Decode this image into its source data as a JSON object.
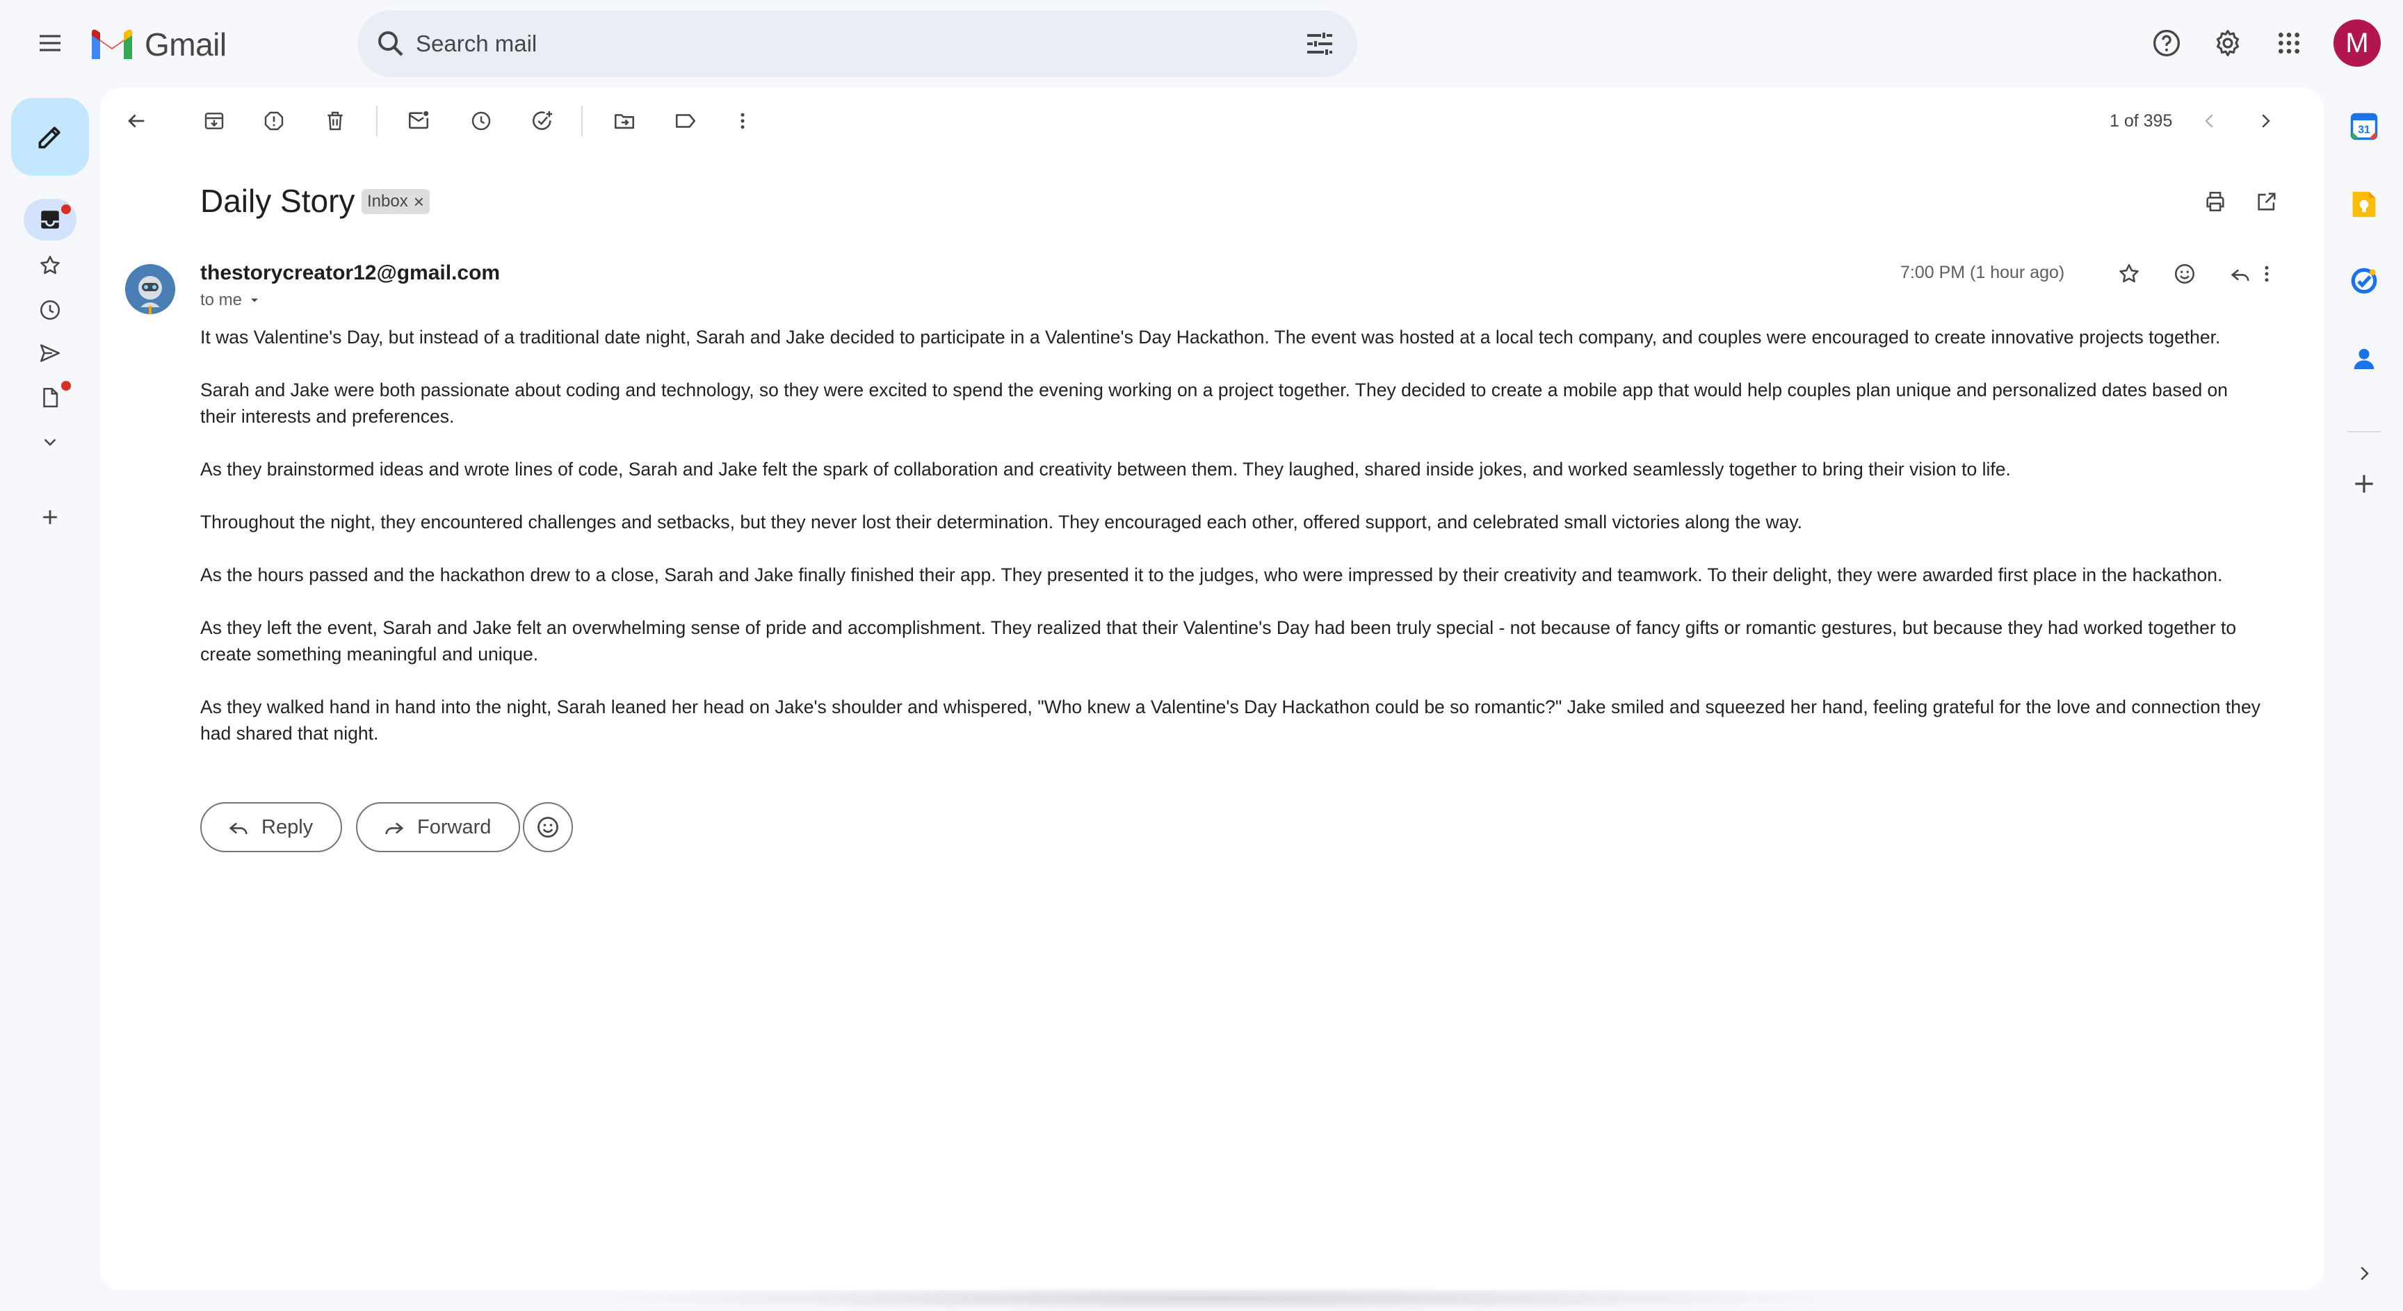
{
  "app": {
    "name": "Gmail"
  },
  "search": {
    "placeholder": "Search mail"
  },
  "account": {
    "initial": "M"
  },
  "toolbar": {
    "counter": "1 of 395"
  },
  "email": {
    "subject": "Daily Story",
    "label": "Inbox",
    "sender": "thestorycreator12@gmail.com",
    "recipient": "to me",
    "time": "7:00 PM (1 hour ago)",
    "paragraphs": [
      "It was Valentine's Day, but instead of a traditional date night, Sarah and Jake decided to participate in a Valentine's Day Hackathon. The event was hosted at a local tech company, and couples were encouraged to create innovative projects together.",
      "Sarah and Jake were both passionate about coding and technology, so they were excited to spend the evening working on a project together. They decided to create a mobile app that would help couples plan unique and personalized dates based on their interests and preferences.",
      "As they brainstormed ideas and wrote lines of code, Sarah and Jake felt the spark of collaboration and creativity between them. They laughed, shared inside jokes, and worked seamlessly together to bring their vision to life.",
      "Throughout the night, they encountered challenges and setbacks, but they never lost their determination. They encouraged each other, offered support, and celebrated small victories along the way.",
      "As the hours passed and the hackathon drew to a close, Sarah and Jake finally finished their app. They presented it to the judges, who were impressed by their creativity and teamwork. To their delight, they were awarded first place in the hackathon.",
      "As they left the event, Sarah and Jake felt an overwhelming sense of pride and accomplishment. They realized that their Valentine's Day had been truly special - not because of fancy gifts or romantic gestures, but because they had worked together to create something meaningful and unique.",
      "As they walked hand in hand into the night, Sarah leaned her head on Jake's shoulder and whispered, \"Who knew a Valentine's Day Hackathon could be so romantic?\" Jake smiled and squeezed her hand, feeling grateful for the love and connection they had shared that night."
    ]
  },
  "actions": {
    "reply": "Reply",
    "forward": "Forward"
  },
  "side_panel": {
    "calendar_day": "31"
  },
  "icons": {
    "menu": "hamburger-menu-icon",
    "search": "search-icon",
    "filter": "tune-icon",
    "help": "help-icon",
    "settings": "gear-icon",
    "apps": "apps-grid-icon",
    "compose": "pencil-icon",
    "inbox": "inbox-icon",
    "starred": "star-icon",
    "snoozed": "clock-icon",
    "sent": "send-icon",
    "drafts": "draft-icon",
    "more": "chevron-down-icon",
    "new_label": "plus-icon"
  },
  "colors": {
    "background": "#f6f8fc",
    "search_bg": "#e9eef6",
    "compose_bg": "#c2e7ff",
    "active_nav": "#d3e3fd",
    "avatar": "#b3164f",
    "notification_dot": "#d93025"
  }
}
